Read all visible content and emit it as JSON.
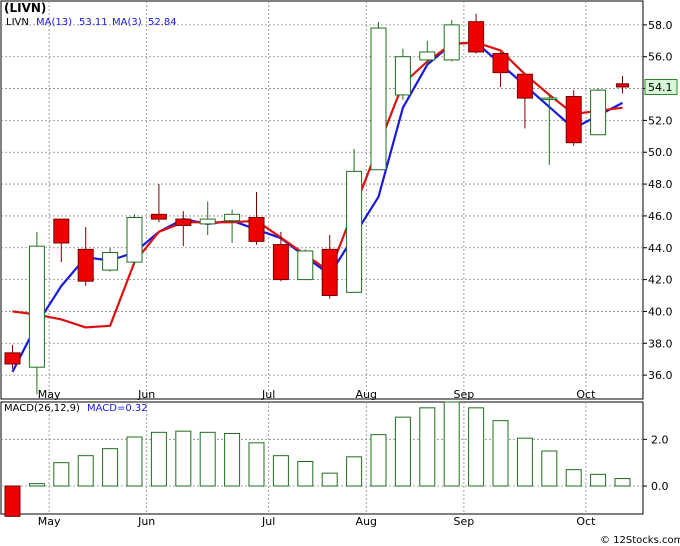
{
  "chart_data": [
    {
      "type": "candlestick",
      "ticker": "(LIVN)",
      "legend_label": "LIVN",
      "ma13_label": "MA(13)",
      "ma13_value": "53.11",
      "ma3_label": "MA(3)",
      "ma3_value": "52.84",
      "last_price_label": "54.1",
      "last_price": 54.1,
      "ylim": [
        34.5,
        59.5
      ],
      "y_ticks": [
        36,
        38,
        40,
        42,
        44,
        46,
        48,
        50,
        52,
        54,
        56,
        58
      ],
      "y_tick_labels": [
        "36.0",
        "38.0",
        "40.0",
        "42.0",
        "44.0",
        "46.0",
        "48.0",
        "50.0",
        "52.0",
        "54.0",
        "56.0",
        "58.0"
      ],
      "x_labels": [
        "May",
        "Jun",
        "Jul",
        "Aug",
        "Sep",
        "Oct"
      ],
      "x_label_index": [
        1.5,
        5.5,
        10.5,
        14.5,
        18.5,
        23.5
      ],
      "candles": [
        {
          "o": 37.4,
          "h": 37.9,
          "l": 36.4,
          "c": 36.7
        },
        {
          "o": 36.5,
          "h": 45.0,
          "l": 34.8,
          "c": 44.1
        },
        {
          "o": 45.8,
          "h": 45.8,
          "l": 43.1,
          "c": 44.3
        },
        {
          "o": 43.9,
          "h": 45.3,
          "l": 41.6,
          "c": 41.9
        },
        {
          "o": 42.6,
          "h": 44.0,
          "l": 42.5,
          "c": 43.7
        },
        {
          "o": 43.1,
          "h": 46.1,
          "l": 42.9,
          "c": 45.9
        },
        {
          "o": 46.1,
          "h": 48.0,
          "l": 45.6,
          "c": 45.8
        },
        {
          "o": 45.8,
          "h": 46.3,
          "l": 44.1,
          "c": 45.4
        },
        {
          "o": 45.5,
          "h": 46.9,
          "l": 44.8,
          "c": 45.8
        },
        {
          "o": 45.7,
          "h": 46.4,
          "l": 44.3,
          "c": 46.1
        },
        {
          "o": 45.9,
          "h": 47.5,
          "l": 44.2,
          "c": 44.4
        },
        {
          "o": 44.2,
          "h": 45.0,
          "l": 41.9,
          "c": 42.0
        },
        {
          "o": 42.0,
          "h": 43.9,
          "l": 42.0,
          "c": 43.8
        },
        {
          "o": 43.9,
          "h": 44.8,
          "l": 40.8,
          "c": 41.0
        },
        {
          "o": 41.2,
          "h": 50.2,
          "l": 41.2,
          "c": 48.8
        },
        {
          "o": 48.9,
          "h": 58.2,
          "l": 48.9,
          "c": 57.8
        },
        {
          "o": 53.6,
          "h": 56.5,
          "l": 53.3,
          "c": 56.0
        },
        {
          "o": 55.8,
          "h": 57.0,
          "l": 55.5,
          "c": 56.3
        },
        {
          "o": 55.8,
          "h": 58.3,
          "l": 55.7,
          "c": 58.0
        },
        {
          "o": 58.2,
          "h": 58.7,
          "l": 56.2,
          "c": 56.3
        },
        {
          "o": 56.2,
          "h": 56.3,
          "l": 54.1,
          "c": 55.0
        },
        {
          "o": 54.9,
          "h": 54.9,
          "l": 51.5,
          "c": 53.4
        },
        {
          "o": 53.4,
          "h": 53.6,
          "l": 49.2,
          "c": 53.4
        },
        {
          "o": 53.5,
          "h": 53.9,
          "l": 50.4,
          "c": 50.6
        },
        {
          "o": 51.1,
          "h": 54.0,
          "l": 51.1,
          "c": 53.9
        },
        {
          "o": 54.3,
          "h": 54.8,
          "l": 53.7,
          "c": 54.1
        }
      ],
      "ma3_series": [
        40.0,
        39.8,
        39.5,
        39.0,
        39.1,
        43.1,
        45.0,
        45.6,
        45.6,
        45.6,
        45.7,
        null,
        null,
        42.5,
        null,
        null,
        54.3,
        55.7,
        56.8,
        56.9,
        56.4,
        54.9,
        53.6,
        52.4,
        52.6,
        52.8
      ],
      "ma13_series": [
        36.2,
        39.2,
        41.6,
        43.4,
        43.2,
        43.7,
        45.0,
        45.8,
        45.5,
        45.7,
        null,
        44.6,
        null,
        42.3,
        null,
        47.2,
        52.8,
        55.5,
        56.8,
        56.9,
        null,
        null,
        null,
        51.5,
        52.3,
        53.1
      ],
      "ma3_color": "#dd1111",
      "ma13_color": "#1a1add",
      "up_fill": "#ffffff",
      "up_stroke": "#1f6f1f",
      "down_fill": "#ee0000",
      "down_stroke": "#7a0000"
    },
    {
      "type": "bar",
      "macd_label": "MACD(26,12,9)",
      "macd_value_label": "MACD=0.32",
      "ylim": [
        -1.2,
        3.6
      ],
      "y_ticks": [
        0,
        2
      ],
      "y_tick_labels": [
        "0.0",
        "2.0"
      ],
      "x_labels": [
        "May",
        "Jun",
        "Jul",
        "Aug",
        "Sep",
        "Oct"
      ],
      "values": [
        -1.3,
        0.1,
        1.0,
        1.3,
        1.6,
        2.1,
        2.3,
        2.35,
        2.3,
        2.25,
        1.85,
        1.3,
        1.05,
        0.55,
        1.25,
        2.2,
        2.95,
        3.35,
        3.6,
        3.35,
        2.8,
        2.05,
        1.5,
        0.7,
        0.5,
        0.32
      ],
      "pos_color": "#1f6f1f",
      "neg_fill": "#ee0000"
    }
  ],
  "footer": {
    "copyright": "© 12Stocks.com"
  }
}
